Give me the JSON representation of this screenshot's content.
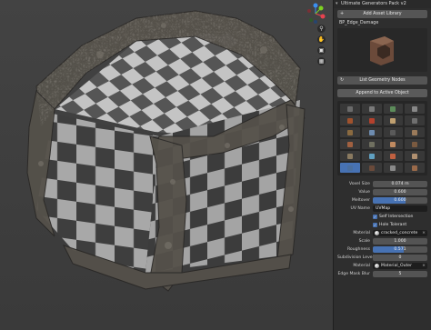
{
  "panel": {
    "title": "Ultimate Generators Pack v2",
    "add_asset_library": "Add Asset Library",
    "asset_name": "BP_Edge_Damage",
    "list_geometry_nodes": "List Geometry Nodes",
    "append_to_active": "Append to Active Object"
  },
  "grid_icons": [
    {
      "color": "#6a6a6a"
    },
    {
      "color": "#7a7a7a"
    },
    {
      "color": "#5c8c5a"
    },
    {
      "color": "#888888"
    },
    {
      "color": "#a0522d"
    },
    {
      "color": "#b4412d"
    },
    {
      "color": "#c0a070"
    },
    {
      "color": "#6f6f6f"
    },
    {
      "color": "#8a6a40"
    },
    {
      "color": "#6e8cb0"
    },
    {
      "color": "#5a5a5a"
    },
    {
      "color": "#9a7a5a"
    },
    {
      "color": "#a06040"
    },
    {
      "color": "#707060"
    },
    {
      "color": "#c08a60"
    },
    {
      "color": "#7a5a40"
    },
    {
      "color": "#8a7a60"
    },
    {
      "color": "#60a0c0"
    },
    {
      "color": "#c06040"
    },
    {
      "color": "#b09070"
    },
    {
      "color": "#4a6fa0"
    },
    {
      "color": "#6a4a3a"
    },
    {
      "color": "#8a8a8a"
    },
    {
      "color": "#9a6a4a"
    }
  ],
  "selected_index": 20,
  "properties": {
    "voxel_size": {
      "label": "Voxel Size",
      "value": "0.074 m"
    },
    "value": {
      "label": "Value",
      "value": "0.600"
    },
    "meltover": {
      "label": "Meltover",
      "value": "0.600",
      "fraction": 0.6
    },
    "uv_name": {
      "label": "UV Name",
      "value": "UVMap"
    },
    "self_intersection": {
      "label": "Self Intersection",
      "checked": true
    },
    "hole_tolerant": {
      "label": "Hole Tolerant",
      "checked": true
    },
    "material": {
      "label": "Material",
      "value": "cracked_concrete"
    },
    "scale": {
      "label": "Scale",
      "value": "1.000"
    },
    "roughness": {
      "label": "Roughness",
      "value": "0.571",
      "fraction": 0.571
    },
    "subdivision_level": {
      "label": "Subdivision Level",
      "value": "0"
    },
    "material2": {
      "label": "Material",
      "value": "Material_Outer"
    },
    "edge_mask_blur": {
      "label": "Edge Mask Blur",
      "value": "5"
    }
  },
  "gizmo": {
    "x_color": "#e8424f",
    "y_color": "#7ed321",
    "z_color": "#3b8ff0"
  }
}
